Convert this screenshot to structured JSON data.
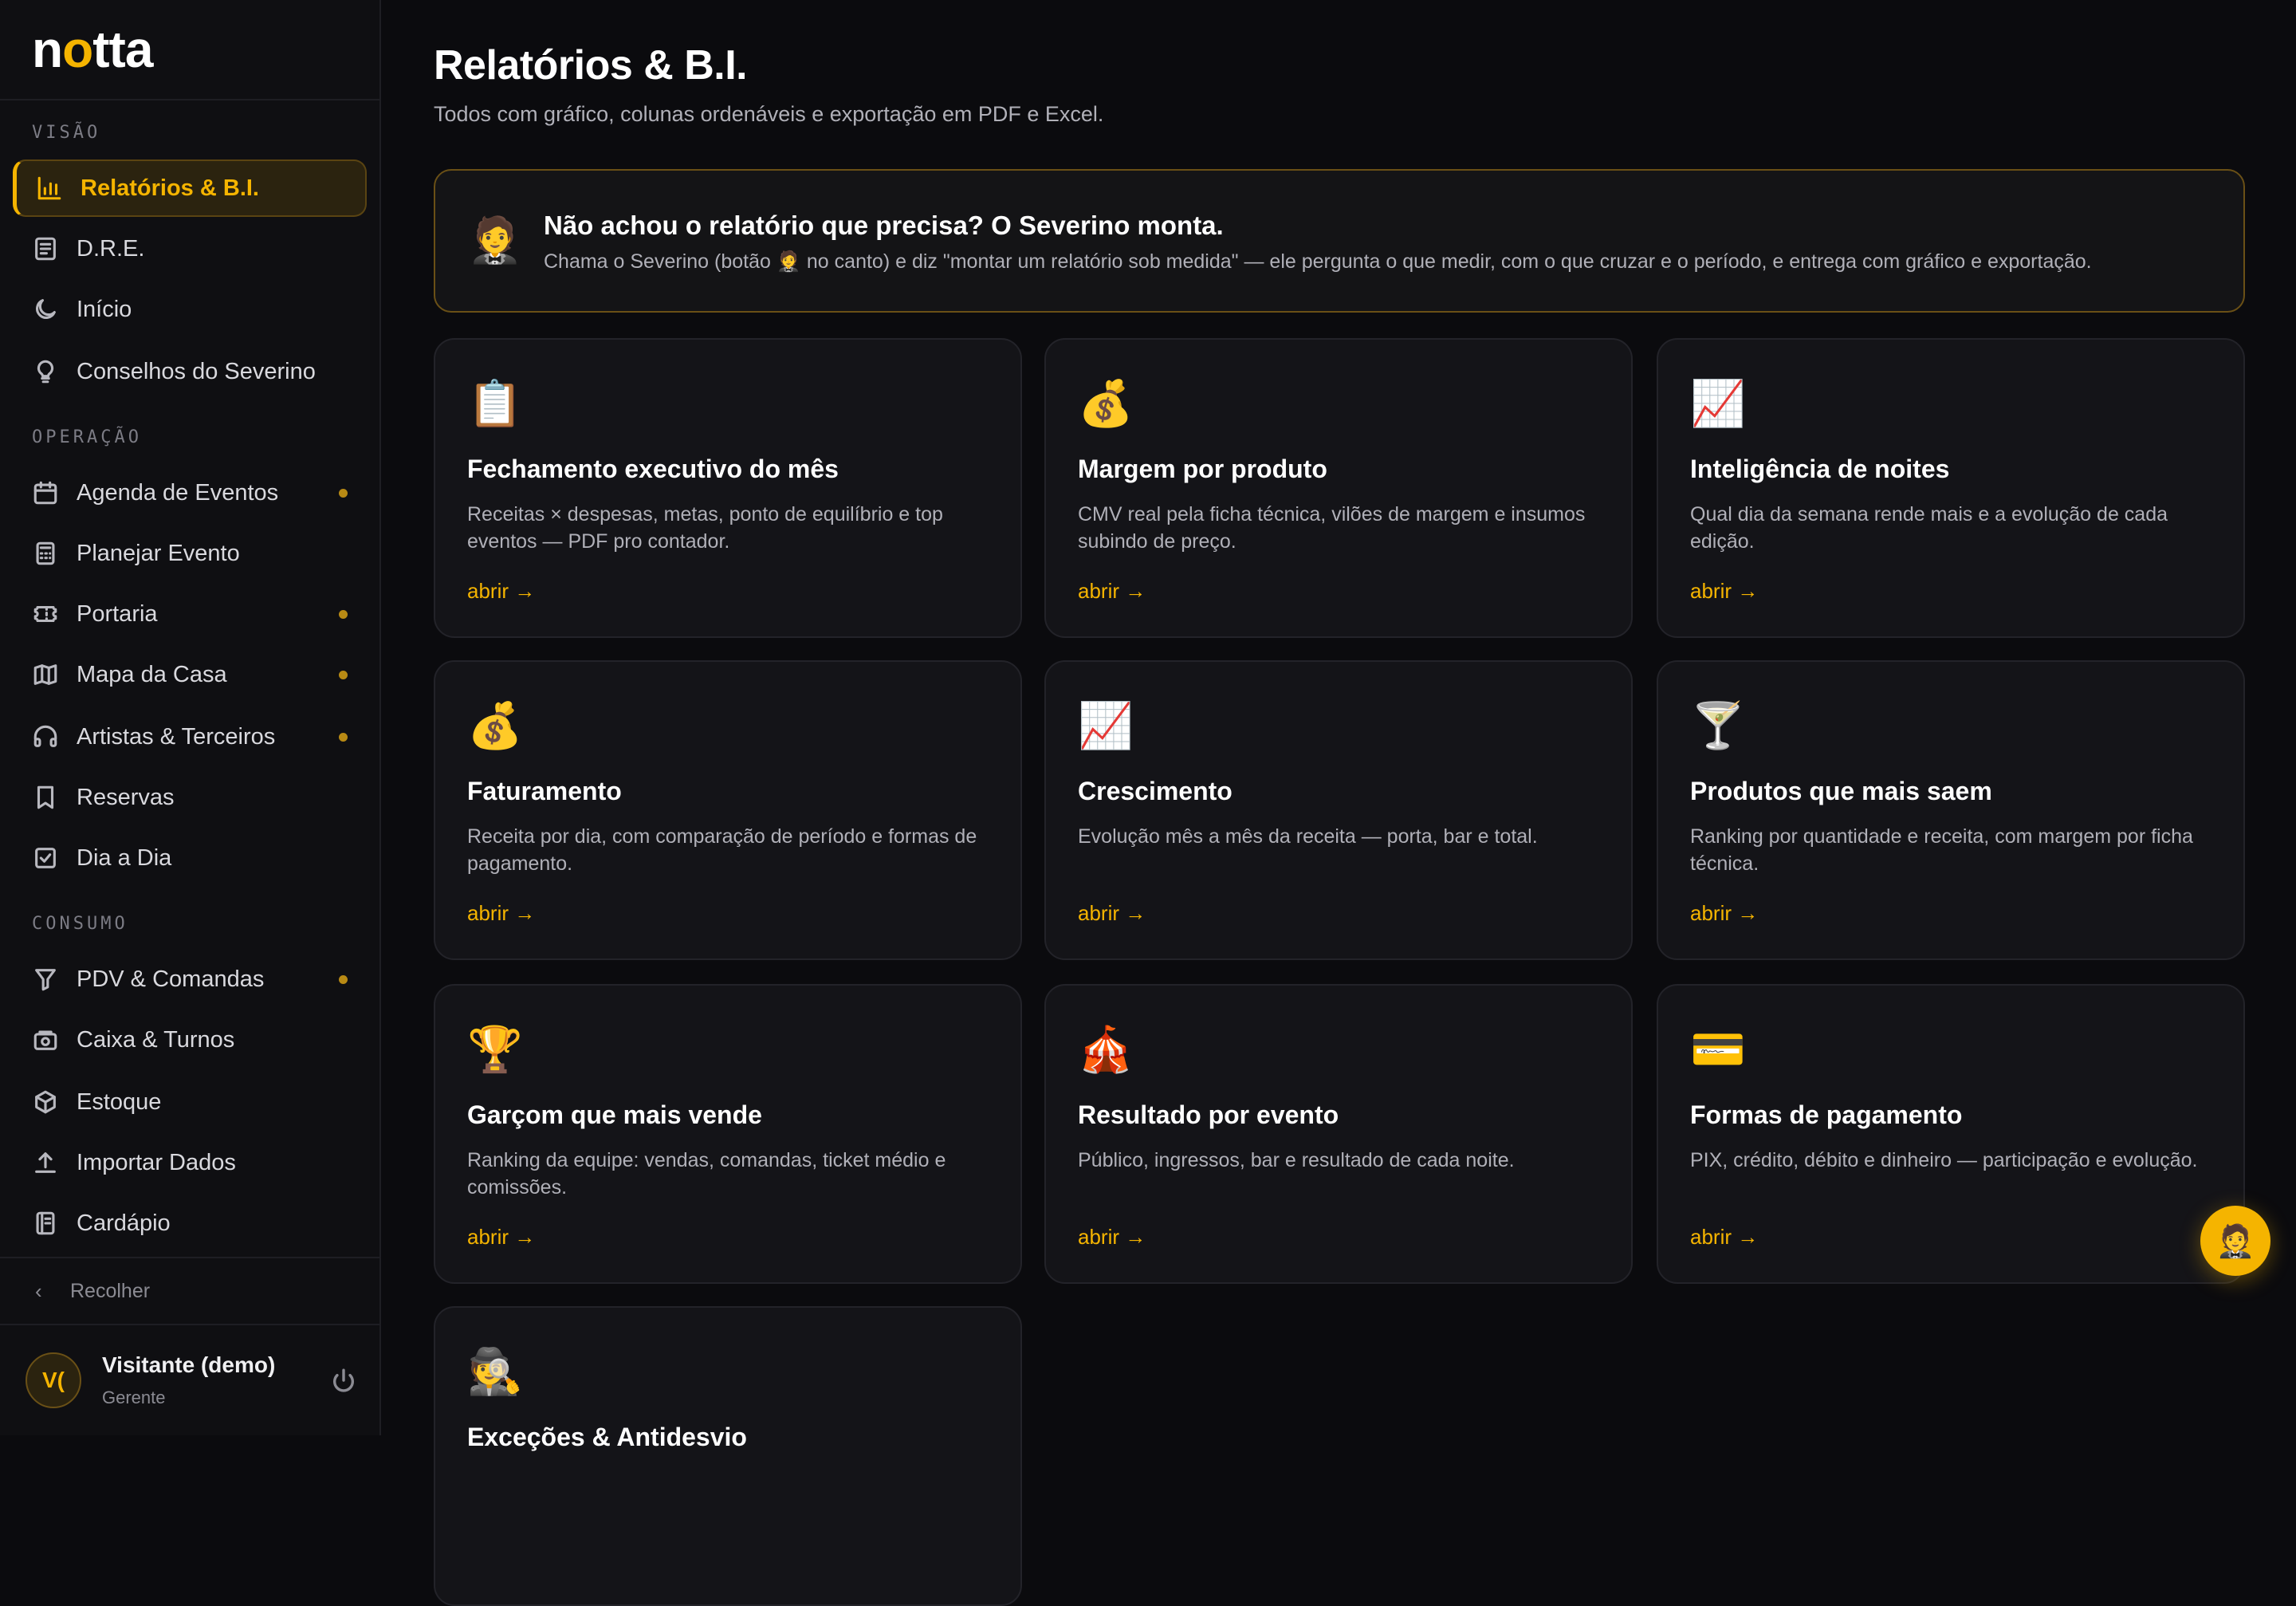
{
  "sidebar": {
    "logo": {
      "pre": "n",
      "moon": "o",
      "post": "tta"
    },
    "sections": {
      "visao": "VISÃO",
      "operacao": "OPERAÇÃO",
      "consumo": "CONSUMO"
    },
    "items": [
      {
        "label": "Relatórios & B.I.",
        "icon": "bar-chart-icon",
        "active": true
      },
      {
        "label": "D.R.E.",
        "icon": "document-icon"
      },
      {
        "label": "Início",
        "icon": "moon-icon"
      },
      {
        "label": "Conselhos do Severino",
        "icon": "lightbulb-icon"
      },
      {
        "label": "Agenda de Eventos",
        "icon": "calendar-icon",
        "dot": true
      },
      {
        "label": "Planejar Evento",
        "icon": "calculator-icon"
      },
      {
        "label": "Portaria",
        "icon": "ticket-icon",
        "dot": true
      },
      {
        "label": "Mapa da Casa",
        "icon": "map-icon",
        "dot": true
      },
      {
        "label": "Artistas & Terceiros",
        "icon": "headphones-icon",
        "dot": true
      },
      {
        "label": "Reservas",
        "icon": "bookmark-icon"
      },
      {
        "label": "Dia a Dia",
        "icon": "checkbox-icon"
      },
      {
        "label": "PDV & Comandas",
        "icon": "filter-icon",
        "dot": true
      },
      {
        "label": "Caixa & Turnos",
        "icon": "cash-register-icon"
      },
      {
        "label": "Estoque",
        "icon": "box-icon"
      },
      {
        "label": "Importar Dados",
        "icon": "upload-icon"
      },
      {
        "label": "Cardápio",
        "icon": "menu-book-icon"
      }
    ],
    "collapse_label": "Recolher",
    "user": {
      "initials": "V(",
      "name": "Visitante (demo)",
      "role": "Gerente"
    }
  },
  "main": {
    "title": "Relatórios & B.I.",
    "subtitle": "Todos com gráfico, colunas ordenáveis e exportação em PDF e Excel.",
    "banner": {
      "emoji": "🤵",
      "title": "Não achou o relatório que precisa? O Severino monta.",
      "text": "Chama o Severino (botão 🤵 no canto) e diz \"montar um relatório sob medida\" — ele pergunta o que medir, com o que cruzar e o período, e entrega com gráfico e exportação."
    },
    "link_label": "abrir →",
    "cards": [
      {
        "emoji": "📋",
        "title": "Fechamento executivo do mês",
        "desc": "Receitas × despesas, metas, ponto de equilíbrio e top eventos — PDF pro contador."
      },
      {
        "emoji": "💰",
        "title": "Margem por produto",
        "desc": "CMV real pela ficha técnica, vilões de margem e insumos subindo de preço."
      },
      {
        "emoji": "📈",
        "title": "Inteligência de noites",
        "desc": "Qual dia da semana rende mais e a evolução de cada edição."
      },
      {
        "emoji": "💰",
        "title": "Faturamento",
        "desc": "Receita por dia, com comparação de período e formas de pagamento."
      },
      {
        "emoji": "📈",
        "title": "Crescimento",
        "desc": "Evolução mês a mês da receita — porta, bar e total."
      },
      {
        "emoji": "🍸",
        "title": "Produtos que mais saem",
        "desc": "Ranking por quantidade e receita, com margem por ficha técnica."
      },
      {
        "emoji": "🏆",
        "title": "Garçom que mais vende",
        "desc": "Ranking da equipe: vendas, comandas, ticket médio e comissões."
      },
      {
        "emoji": "🎪",
        "title": "Resultado por evento",
        "desc": "Público, ingressos, bar e resultado de cada noite."
      },
      {
        "emoji": "💳",
        "title": "Formas de pagamento",
        "desc": "PIX, crédito, débito e dinheiro — participação e evolução."
      },
      {
        "emoji": "🕵️",
        "title": "Exceções & Antidesvio",
        "desc": ""
      }
    ]
  },
  "fab": {
    "emoji": "🤵"
  },
  "colors": {
    "accent": "#f5b400",
    "background": "#0b0b0e",
    "card": "#141418"
  }
}
